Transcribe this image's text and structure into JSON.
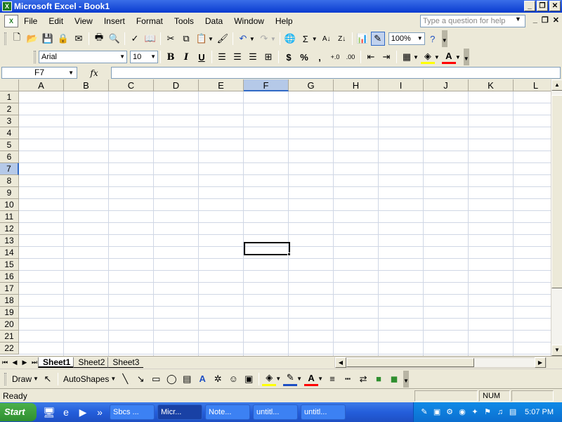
{
  "window": {
    "title": "Microsoft Excel - Book1"
  },
  "menu": [
    "File",
    "Edit",
    "View",
    "Insert",
    "Format",
    "Tools",
    "Data",
    "Window",
    "Help"
  ],
  "ask_placeholder": "Type a question for help",
  "standard_toolbar": {
    "zoom": "100%"
  },
  "formatting_toolbar": {
    "font": "Arial",
    "size": "10",
    "bold": "B",
    "italic": "I",
    "underline": "U",
    "currency": "$",
    "percent": "%",
    "comma": ","
  },
  "formula_bar": {
    "name_box": "F7",
    "fx": "fx",
    "value": ""
  },
  "grid": {
    "columns": [
      "A",
      "B",
      "C",
      "D",
      "E",
      "F",
      "G",
      "H",
      "I",
      "J",
      "K",
      "L"
    ],
    "rows": [
      "1",
      "2",
      "3",
      "4",
      "5",
      "6",
      "7",
      "8",
      "9",
      "10",
      "11",
      "12",
      "13",
      "14",
      "15",
      "16",
      "17",
      "18",
      "19",
      "20",
      "21",
      "22"
    ],
    "selected_column": "F",
    "selected_row": "7"
  },
  "sheets": [
    "Sheet1",
    "Sheet2",
    "Sheet3"
  ],
  "active_sheet": "Sheet1",
  "drawing_toolbar": {
    "draw": "Draw",
    "autoshapes": "AutoShapes"
  },
  "status": {
    "text": "Ready",
    "num": "NUM"
  },
  "taskbar": {
    "start": "Start",
    "tasks": [
      "Sbcs ...",
      "Micr...",
      "Note...",
      "untitl...",
      "untitl..."
    ],
    "active_task": "Micr...",
    "clock": "5:07 PM"
  }
}
